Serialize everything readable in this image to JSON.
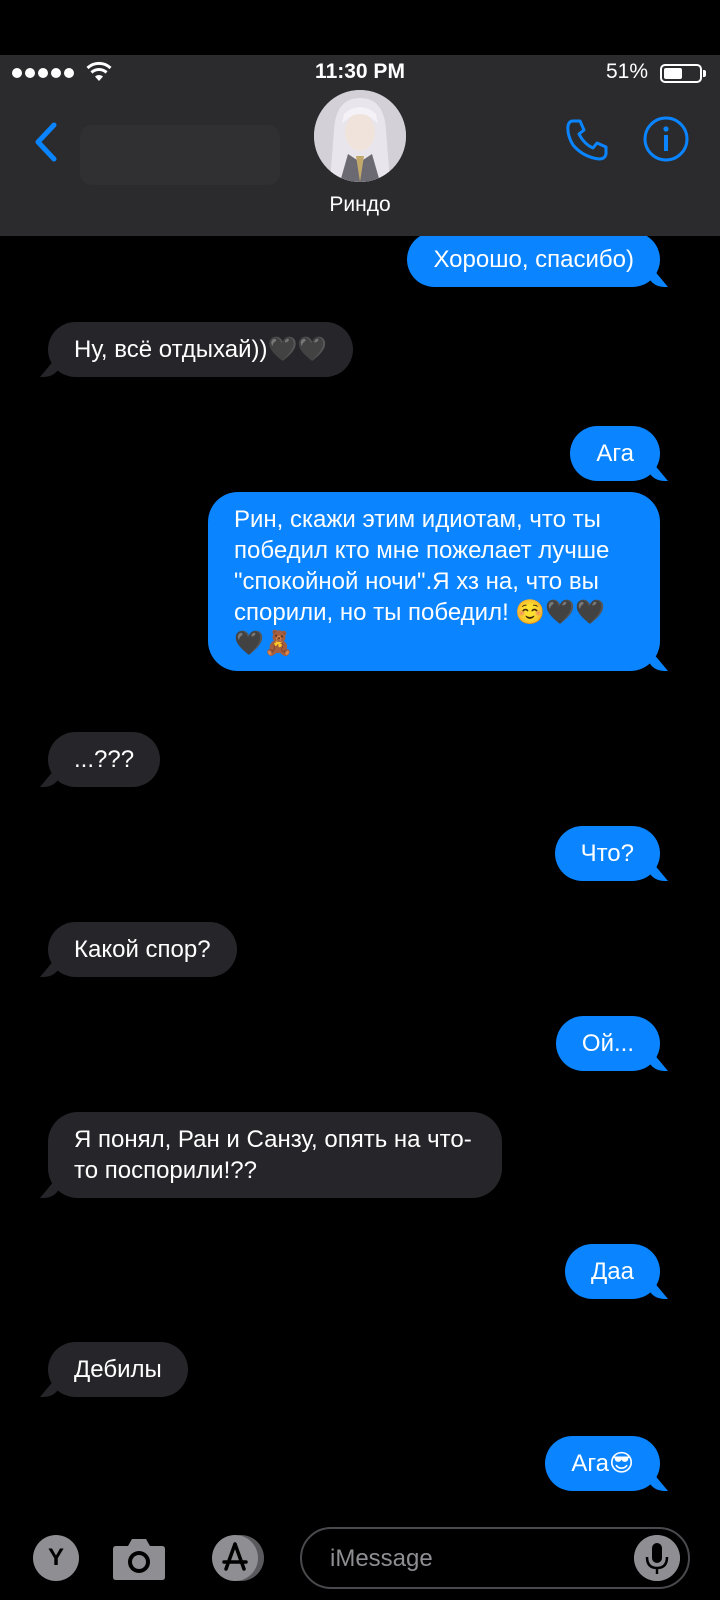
{
  "status_bar": {
    "time": "11:30 PM",
    "battery": "51%"
  },
  "contact": {
    "name": "Риндо"
  },
  "colors": {
    "accent": "#0a84ff",
    "incoming_bubble": "#26252a",
    "header_bg": "#2b2b2d"
  },
  "messages": [
    {
      "dir": "out",
      "text": "Хорошо, спасибо)"
    },
    {
      "dir": "in",
      "text": "Ну, всё отдыхай))🖤🖤"
    },
    {
      "dir": "out",
      "text": "Ага"
    },
    {
      "dir": "out",
      "text": "Рин, скажи этим идиотам, что ты победил кто мне пожелает лучше \"спокойной ночи\".Я хз на, что вы спорили, но ты победил! ☺️🖤🖤🖤🧸"
    },
    {
      "dir": "in",
      "text": "...???"
    },
    {
      "dir": "out",
      "text": "Что?"
    },
    {
      "dir": "in",
      "text": "Какой спор?"
    },
    {
      "dir": "out",
      "text": "Ой..."
    },
    {
      "dir": "in",
      "text": "Я понял, Ран и Санзу, опять на что-то поспорили!??"
    },
    {
      "dir": "out",
      "text": "Даа"
    },
    {
      "dir": "in",
      "text": "Дебилы"
    },
    {
      "dir": "out",
      "text": "Ага😎"
    }
  ],
  "input": {
    "app_label": "Y",
    "placeholder": "iMessage"
  },
  "icons": {
    "back": "chevron-left-icon",
    "call": "phone-icon",
    "info": "info-icon",
    "camera": "camera-icon",
    "appstore": "app-store-icon",
    "mic": "microphone-icon"
  }
}
